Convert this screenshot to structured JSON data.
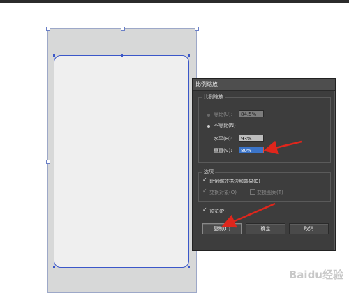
{
  "dialog": {
    "title": "比例缩放",
    "scale_group_label": "比例缩放",
    "uniform_label": "等比(U):",
    "uniform_value": "84.5%",
    "non_uniform_label": "不等比(N)",
    "horizontal_label": "水平(H):",
    "horizontal_value": "93%",
    "vertical_label": "垂直(V):",
    "vertical_value": "80%",
    "options_label": "选项",
    "scale_strokes_label": "比例缩放描边和效果(E)",
    "transform_objects_label": "变换对象(O)",
    "transform_patterns_label": "变换图案(T)",
    "preview_label": "预览(P)",
    "copy_button": "复制(C)",
    "ok_button": "确定",
    "cancel_button": "取消",
    "check_glyph": "✓"
  },
  "watermark": "Baidu经验",
  "colors": {
    "annotation_arrow": "#e0261c",
    "selection_blue": "#3b57c9"
  }
}
